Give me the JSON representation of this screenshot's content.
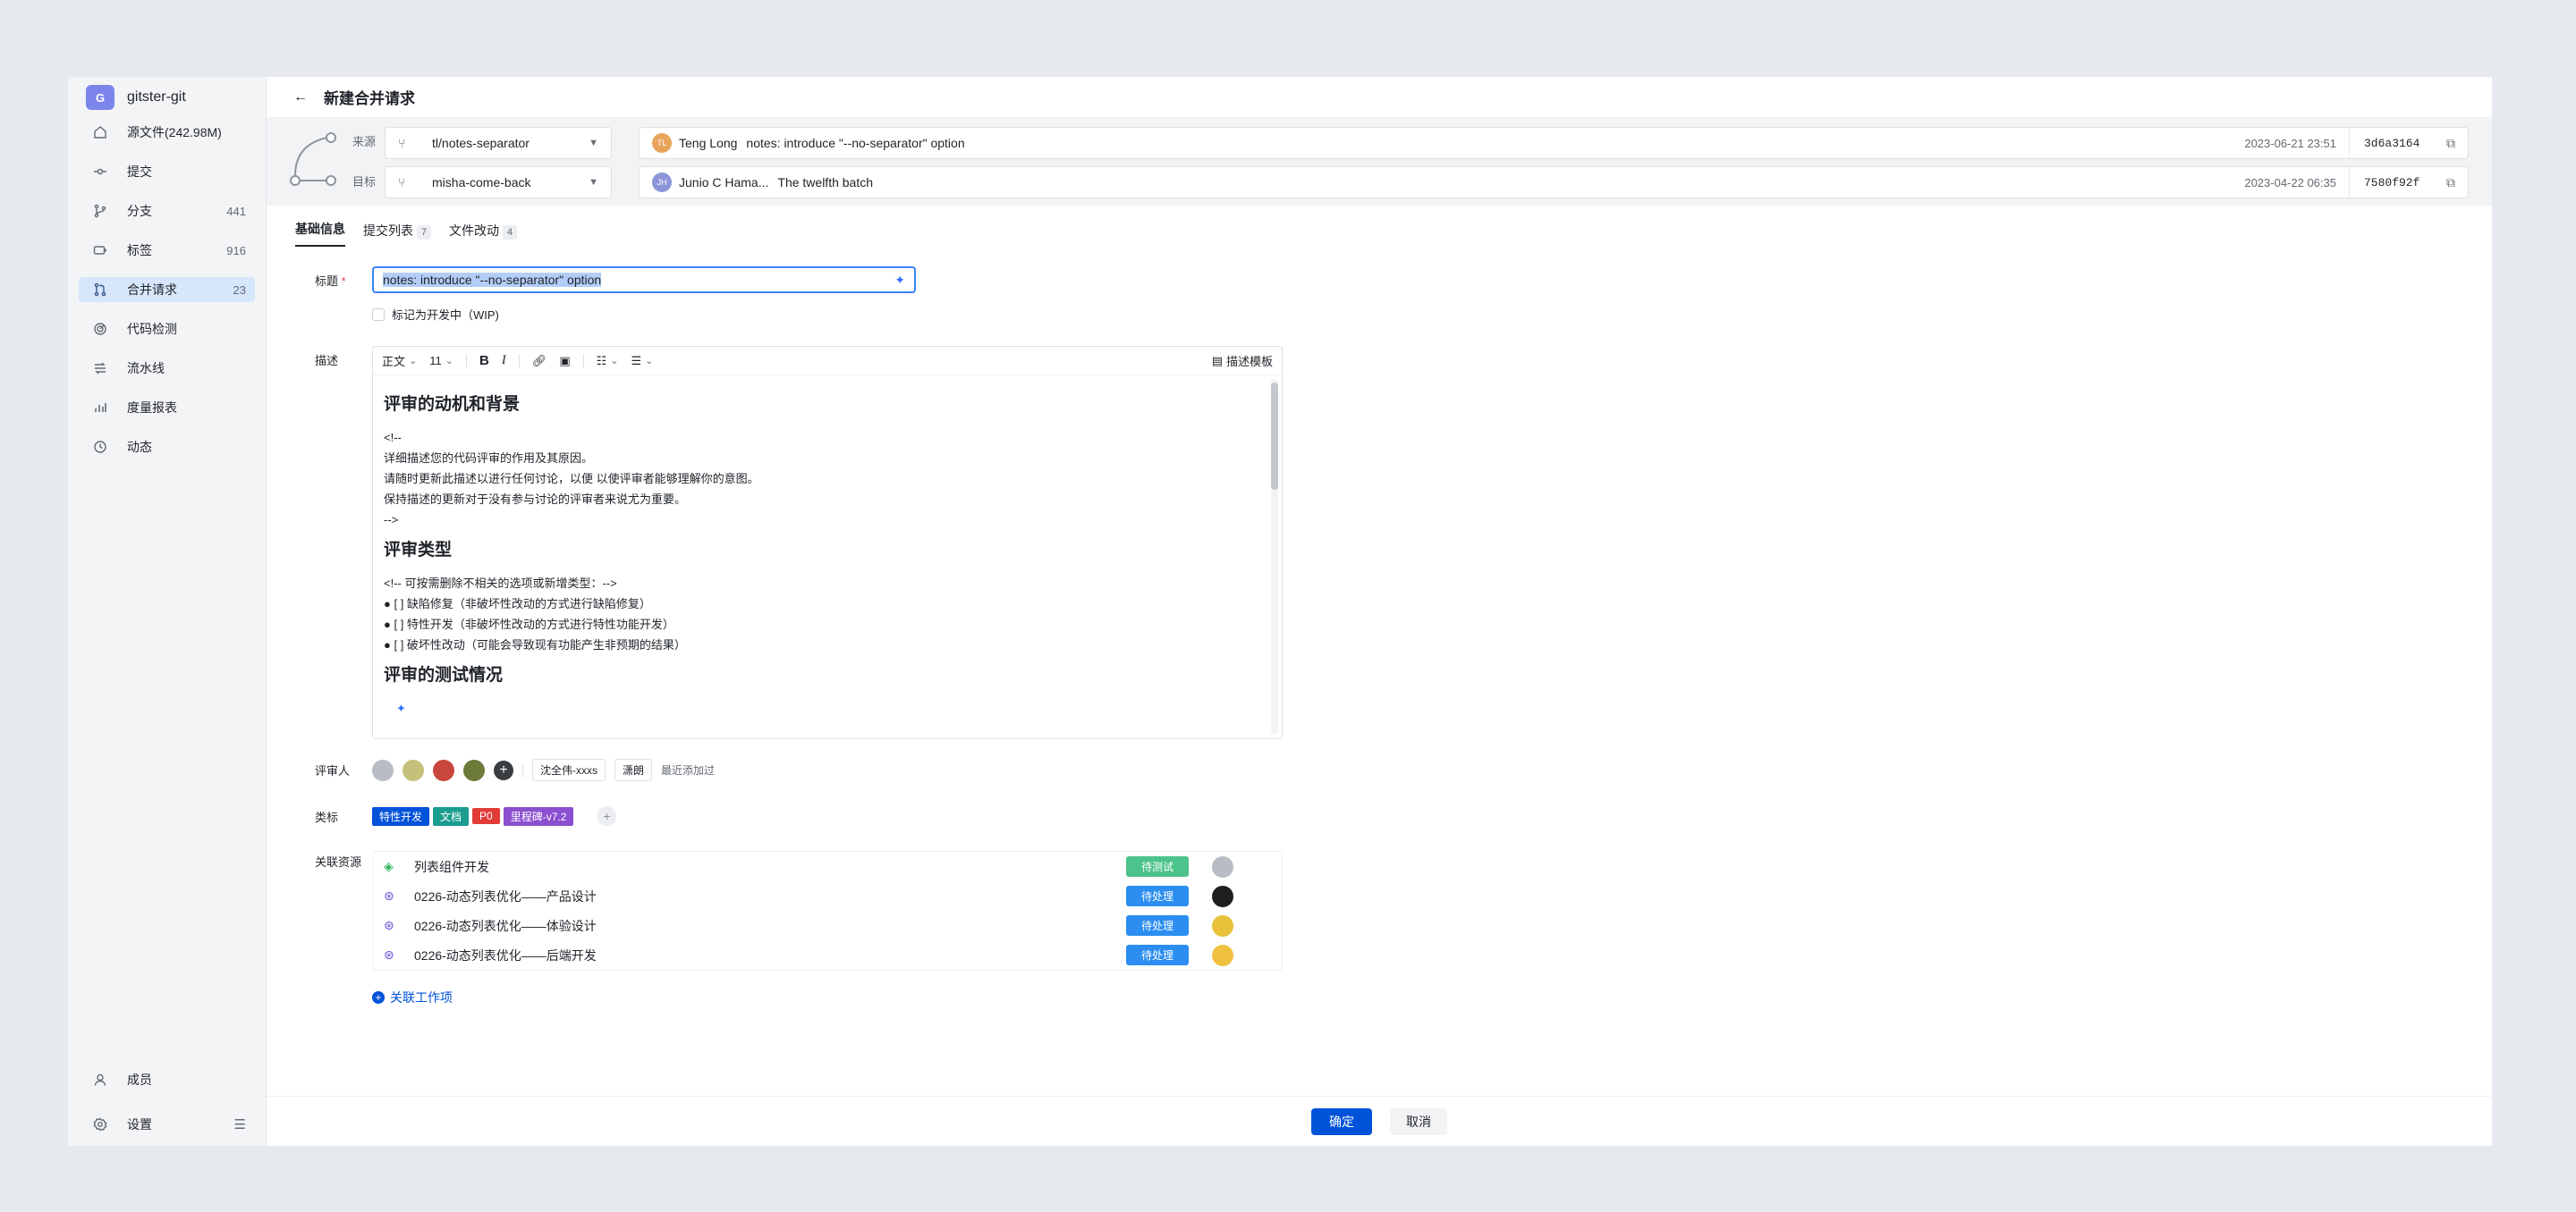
{
  "repo": {
    "initial": "G",
    "name": "gitster-git"
  },
  "sidebar": {
    "items": [
      {
        "label": "源文件(242.98M)",
        "count": ""
      },
      {
        "label": "提交",
        "count": ""
      },
      {
        "label": "分支",
        "count": "441"
      },
      {
        "label": "标签",
        "count": "916"
      },
      {
        "label": "合并请求",
        "count": "23"
      },
      {
        "label": "代码检测",
        "count": ""
      },
      {
        "label": "流水线",
        "count": ""
      },
      {
        "label": "度量报表",
        "count": ""
      },
      {
        "label": "动态",
        "count": ""
      }
    ],
    "bottom": [
      {
        "label": "成员"
      },
      {
        "label": "设置"
      }
    ]
  },
  "header": {
    "title": "新建合并请求"
  },
  "branches": {
    "source_label": "来源",
    "target_label": "目标",
    "source": {
      "branch": "tl/notes-separator",
      "avatar": "TL",
      "author": "Teng Long",
      "message": "notes: introduce \"--no-separator\" option",
      "date": "2023-06-21 23:51",
      "hash": "3d6a3164"
    },
    "target": {
      "branch": "misha-come-back",
      "avatar": "JH",
      "author": "Junio C Hama...",
      "message": "The twelfth batch",
      "date": "2023-04-22 06:35",
      "hash": "7580f92f"
    }
  },
  "tabs": [
    {
      "label": "基础信息",
      "badge": ""
    },
    {
      "label": "提交列表",
      "badge": "7"
    },
    {
      "label": "文件改动",
      "badge": "4"
    }
  ],
  "form": {
    "title_label": "标题",
    "title_required": "*",
    "title_value": "notes: introduce \"--no-separator\" option",
    "wip_label": "标记为开发中（WIP)",
    "desc_label": "描述",
    "reviewers_label": "评审人",
    "labels_label": "类标",
    "resources_label": "关联资源"
  },
  "toolbar": {
    "style": "正文",
    "size": "11",
    "template": "描述模板"
  },
  "editor": {
    "h1": "评审的动机和背景",
    "p1": [
      "<!--",
      "详细描述您的代码评审的作用及其原因。",
      "请随时更新此描述以进行任何讨论，以便 以使评审者能够理解你的意图。",
      "保持描述的更新对于没有参与讨论的评审者来说尤为重要。",
      "-->"
    ],
    "h2": "评审类型",
    "p2": [
      "<!-- 可按需删除不相关的选项或新增类型：-->",
      "● [ ] 缺陷修复（非破坏性改动的方式进行缺陷修复）",
      "● [ ] 特性开发（非破坏性改动的方式进行特性功能开发）",
      "● [ ] 破坏性改动（可能会导致现有功能产生非预期的结果）"
    ],
    "h3": "评审的测试情况"
  },
  "reviewers": {
    "tag1": "沈全伟-xxxs",
    "tag2": "潇朗",
    "hint": "最近添加过"
  },
  "labels": [
    {
      "text": "特性开发",
      "color": "#0052d9"
    },
    {
      "text": "文档",
      "color": "#1a9c8f"
    },
    {
      "text": "P0",
      "color": "#e23c39"
    },
    {
      "text": "里程碑-v7.2",
      "color": "#8b4fcf"
    }
  ],
  "resources": [
    {
      "name": "列表组件开发",
      "status": "待测试",
      "status_color": "#4cc38a"
    },
    {
      "name": "0226-动态列表优化——产品设计",
      "status": "待处理",
      "status_color": "#2b8ef0"
    },
    {
      "name": "0226-动态列表优化——体验设计",
      "status": "待处理",
      "status_color": "#2b8ef0"
    },
    {
      "name": "0226-动态列表优化——后端开发",
      "status": "待处理",
      "status_color": "#2b8ef0"
    }
  ],
  "link_work": "关联工作项",
  "footer": {
    "confirm": "确定",
    "cancel": "取消"
  }
}
